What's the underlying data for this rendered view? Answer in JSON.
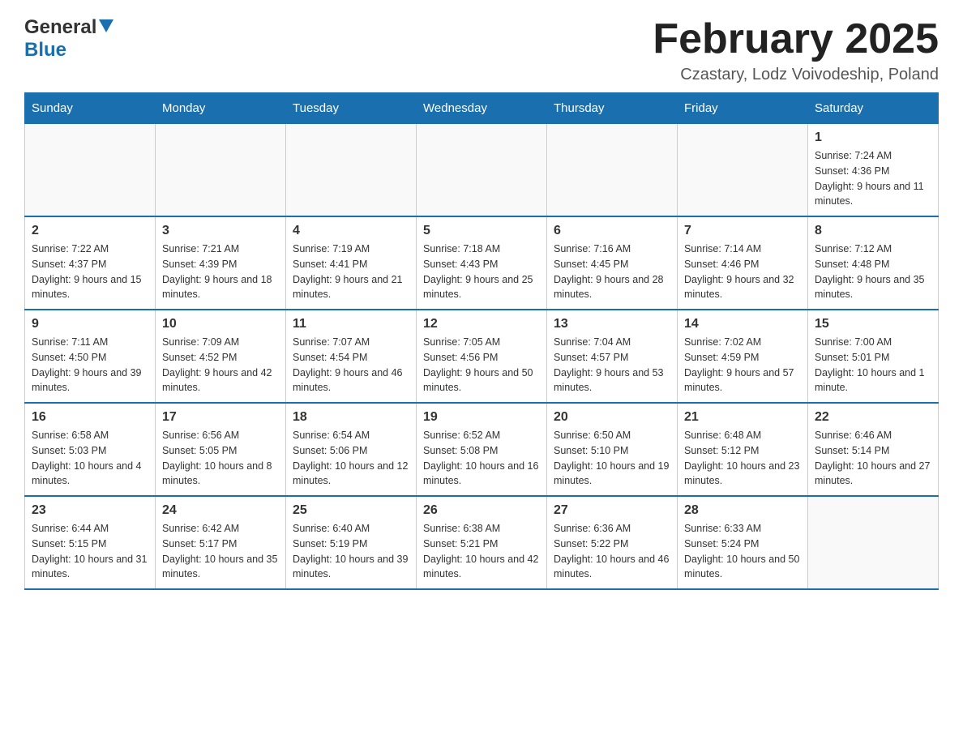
{
  "logo": {
    "general": "General",
    "blue": "Blue"
  },
  "title": "February 2025",
  "subtitle": "Czastary, Lodz Voivodeship, Poland",
  "weekdays": [
    "Sunday",
    "Monday",
    "Tuesday",
    "Wednesday",
    "Thursday",
    "Friday",
    "Saturday"
  ],
  "weeks": [
    [
      {
        "day": "",
        "info": ""
      },
      {
        "day": "",
        "info": ""
      },
      {
        "day": "",
        "info": ""
      },
      {
        "day": "",
        "info": ""
      },
      {
        "day": "",
        "info": ""
      },
      {
        "day": "",
        "info": ""
      },
      {
        "day": "1",
        "info": "Sunrise: 7:24 AM\nSunset: 4:36 PM\nDaylight: 9 hours and 11 minutes."
      }
    ],
    [
      {
        "day": "2",
        "info": "Sunrise: 7:22 AM\nSunset: 4:37 PM\nDaylight: 9 hours and 15 minutes."
      },
      {
        "day": "3",
        "info": "Sunrise: 7:21 AM\nSunset: 4:39 PM\nDaylight: 9 hours and 18 minutes."
      },
      {
        "day": "4",
        "info": "Sunrise: 7:19 AM\nSunset: 4:41 PM\nDaylight: 9 hours and 21 minutes."
      },
      {
        "day": "5",
        "info": "Sunrise: 7:18 AM\nSunset: 4:43 PM\nDaylight: 9 hours and 25 minutes."
      },
      {
        "day": "6",
        "info": "Sunrise: 7:16 AM\nSunset: 4:45 PM\nDaylight: 9 hours and 28 minutes."
      },
      {
        "day": "7",
        "info": "Sunrise: 7:14 AM\nSunset: 4:46 PM\nDaylight: 9 hours and 32 minutes."
      },
      {
        "day": "8",
        "info": "Sunrise: 7:12 AM\nSunset: 4:48 PM\nDaylight: 9 hours and 35 minutes."
      }
    ],
    [
      {
        "day": "9",
        "info": "Sunrise: 7:11 AM\nSunset: 4:50 PM\nDaylight: 9 hours and 39 minutes."
      },
      {
        "day": "10",
        "info": "Sunrise: 7:09 AM\nSunset: 4:52 PM\nDaylight: 9 hours and 42 minutes."
      },
      {
        "day": "11",
        "info": "Sunrise: 7:07 AM\nSunset: 4:54 PM\nDaylight: 9 hours and 46 minutes."
      },
      {
        "day": "12",
        "info": "Sunrise: 7:05 AM\nSunset: 4:56 PM\nDaylight: 9 hours and 50 minutes."
      },
      {
        "day": "13",
        "info": "Sunrise: 7:04 AM\nSunset: 4:57 PM\nDaylight: 9 hours and 53 minutes."
      },
      {
        "day": "14",
        "info": "Sunrise: 7:02 AM\nSunset: 4:59 PM\nDaylight: 9 hours and 57 minutes."
      },
      {
        "day": "15",
        "info": "Sunrise: 7:00 AM\nSunset: 5:01 PM\nDaylight: 10 hours and 1 minute."
      }
    ],
    [
      {
        "day": "16",
        "info": "Sunrise: 6:58 AM\nSunset: 5:03 PM\nDaylight: 10 hours and 4 minutes."
      },
      {
        "day": "17",
        "info": "Sunrise: 6:56 AM\nSunset: 5:05 PM\nDaylight: 10 hours and 8 minutes."
      },
      {
        "day": "18",
        "info": "Sunrise: 6:54 AM\nSunset: 5:06 PM\nDaylight: 10 hours and 12 minutes."
      },
      {
        "day": "19",
        "info": "Sunrise: 6:52 AM\nSunset: 5:08 PM\nDaylight: 10 hours and 16 minutes."
      },
      {
        "day": "20",
        "info": "Sunrise: 6:50 AM\nSunset: 5:10 PM\nDaylight: 10 hours and 19 minutes."
      },
      {
        "day": "21",
        "info": "Sunrise: 6:48 AM\nSunset: 5:12 PM\nDaylight: 10 hours and 23 minutes."
      },
      {
        "day": "22",
        "info": "Sunrise: 6:46 AM\nSunset: 5:14 PM\nDaylight: 10 hours and 27 minutes."
      }
    ],
    [
      {
        "day": "23",
        "info": "Sunrise: 6:44 AM\nSunset: 5:15 PM\nDaylight: 10 hours and 31 minutes."
      },
      {
        "day": "24",
        "info": "Sunrise: 6:42 AM\nSunset: 5:17 PM\nDaylight: 10 hours and 35 minutes."
      },
      {
        "day": "25",
        "info": "Sunrise: 6:40 AM\nSunset: 5:19 PM\nDaylight: 10 hours and 39 minutes."
      },
      {
        "day": "26",
        "info": "Sunrise: 6:38 AM\nSunset: 5:21 PM\nDaylight: 10 hours and 42 minutes."
      },
      {
        "day": "27",
        "info": "Sunrise: 6:36 AM\nSunset: 5:22 PM\nDaylight: 10 hours and 46 minutes."
      },
      {
        "day": "28",
        "info": "Sunrise: 6:33 AM\nSunset: 5:24 PM\nDaylight: 10 hours and 50 minutes."
      },
      {
        "day": "",
        "info": ""
      }
    ]
  ]
}
